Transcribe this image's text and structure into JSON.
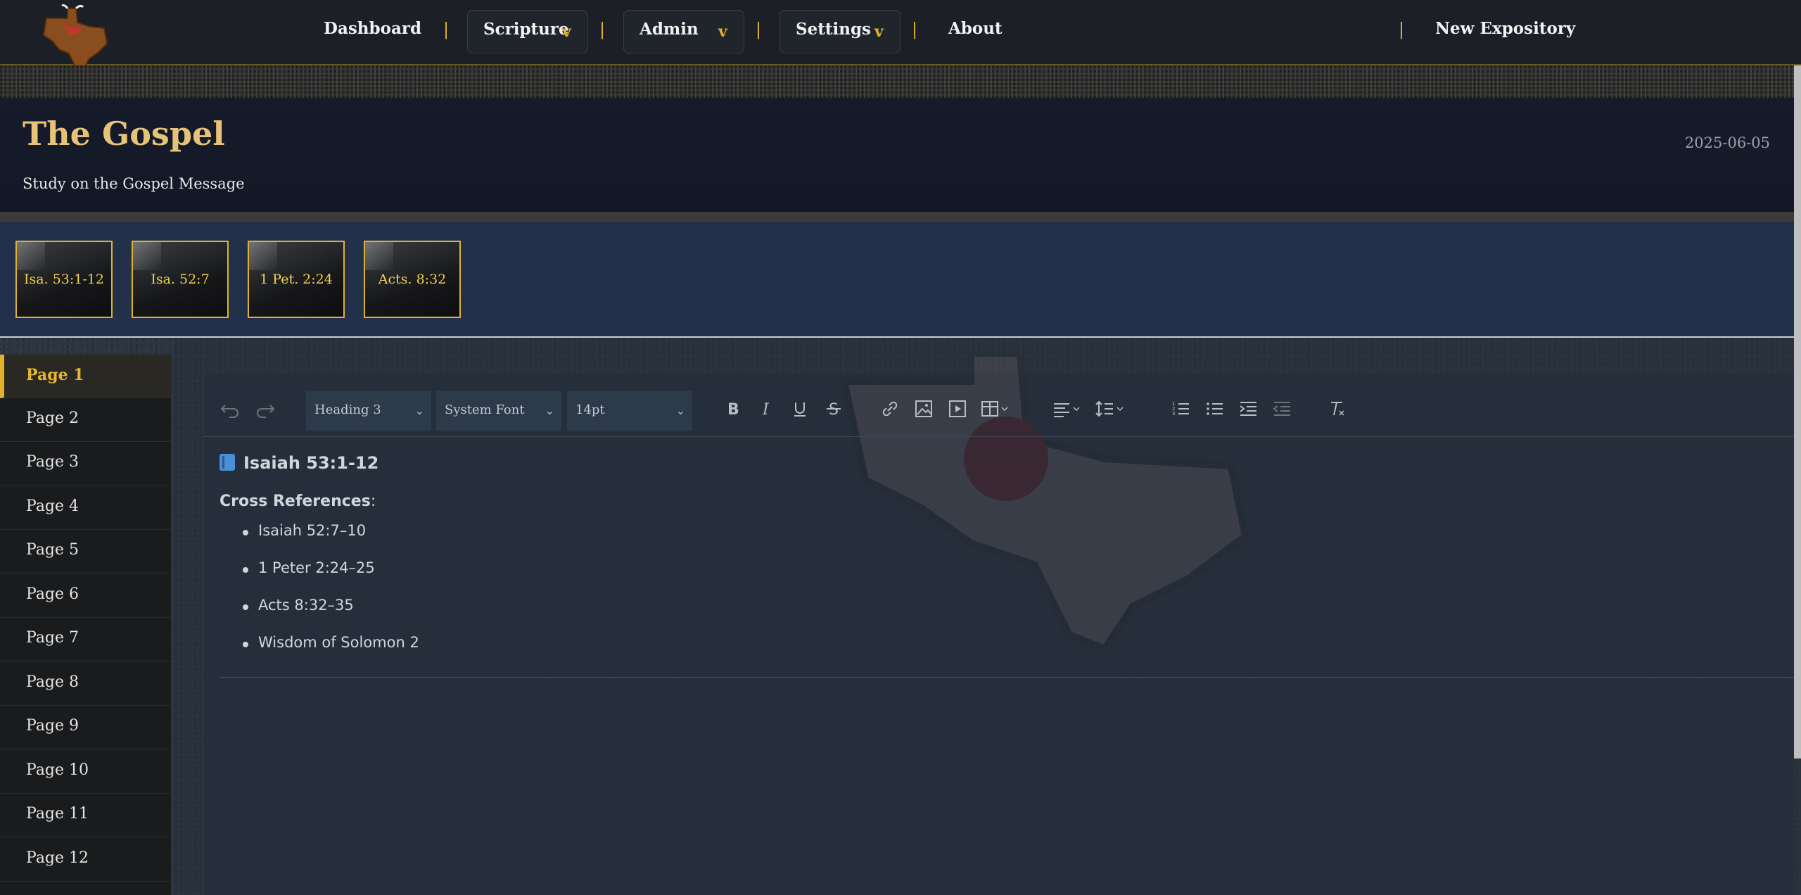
{
  "nav": {
    "dashboard": "Dashboard",
    "scripture": "Scripture",
    "admin": "Admin",
    "settings": "Settings",
    "about": "About",
    "new_expository": "New Expository",
    "separator": "|",
    "chevron": "v"
  },
  "header": {
    "title": "The Gospel",
    "subtitle": "Study on the Gospel Message",
    "date": "2025-06-05"
  },
  "references": [
    "Isa. 53:1-12",
    "Isa. 52:7",
    "1 Pet. 2:24",
    "Acts. 8:32"
  ],
  "pages": [
    "Page 1",
    "Page 2",
    "Page 3",
    "Page 4",
    "Page 5",
    "Page 6",
    "Page 7",
    "Page 8",
    "Page 9",
    "Page 10",
    "Page 11",
    "Page 12"
  ],
  "toolbar": {
    "block_format": "Heading 3",
    "font_family": "System Font",
    "font_size": "14pt",
    "icons": [
      "undo-icon",
      "redo-icon",
      "bold-icon",
      "italic-icon",
      "underline-icon",
      "strikethrough-icon",
      "link-icon",
      "image-icon",
      "media-icon",
      "table-icon",
      "align-icon",
      "line-height-icon",
      "numbered-list-icon",
      "bullet-list-icon",
      "indent-icon",
      "outdent-icon",
      "clear-formatting-icon"
    ]
  },
  "document": {
    "heading": "Isaiah 53:1-12",
    "cross_label": "Cross References",
    "cross_colon": ":",
    "items": [
      "Isaiah 52:7–10",
      "1 Peter 2:24–25",
      "Acts 8:32–35",
      "Wisdom of Solomon 2"
    ]
  },
  "colors": {
    "accent_gold": "#e0b22c",
    "title_gold": "#e6c377",
    "nav_bg": "#1c1f26",
    "header_bg": "#151b2a",
    "refs_bg": "#23304a"
  }
}
